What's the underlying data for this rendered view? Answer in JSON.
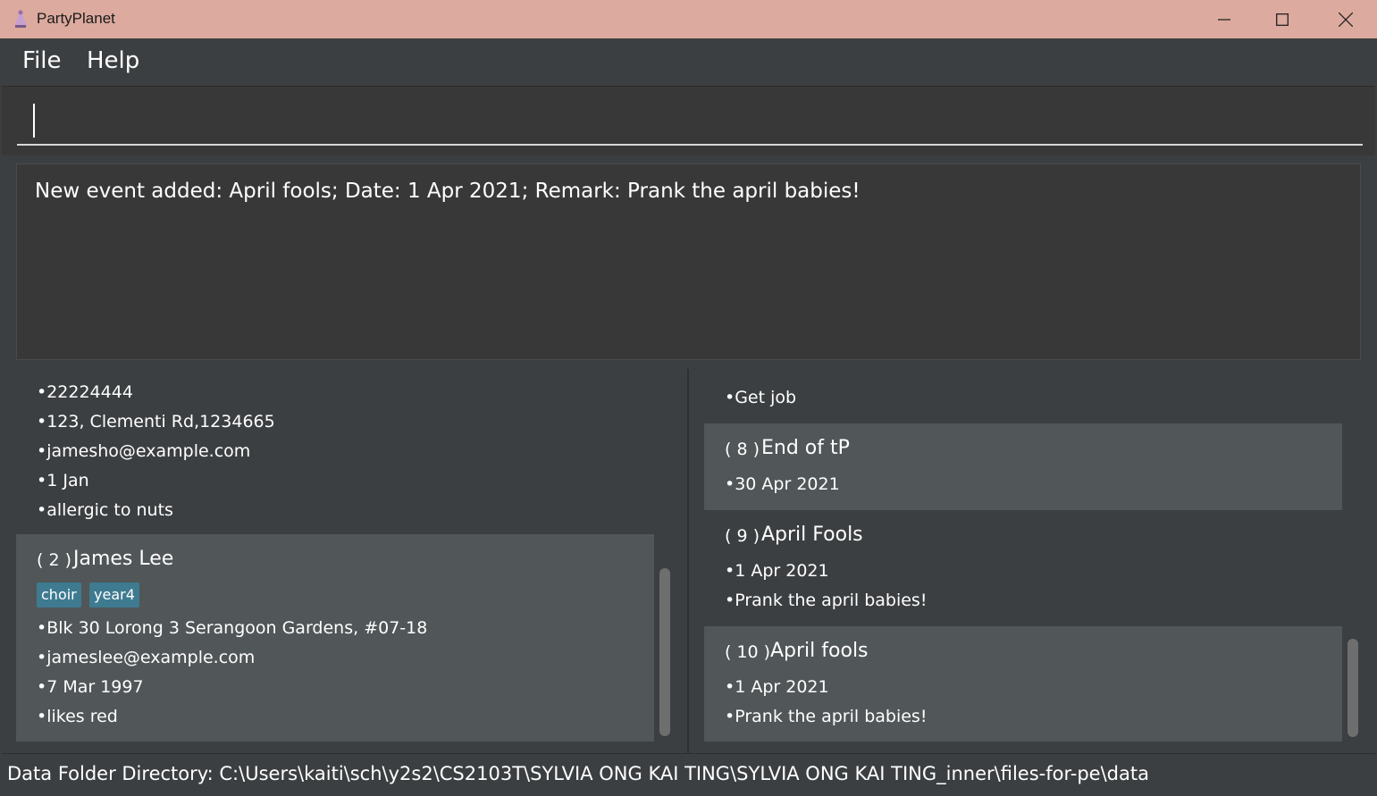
{
  "window": {
    "title": "PartyPlanet"
  },
  "menu": {
    "file": "File",
    "help": "Help"
  },
  "command": {
    "value": ""
  },
  "result": {
    "text": "New event added: April fools; Date: 1 Apr 2021; Remark: Prank the april babies!"
  },
  "persons": [
    {
      "lines": [
        "•22224444",
        "•123, Clementi Rd,1234665",
        "•jamesho@example.com",
        "•1 Jan",
        "•allergic to nuts"
      ]
    },
    {
      "index": "( 2 )",
      "name": "James Lee",
      "tags": [
        "choir",
        "year4"
      ],
      "lines": [
        "•Blk 30 Lorong 3 Serangoon Gardens, #07-18",
        "•jameslee@example.com",
        "•7 Mar 1997",
        "•likes red"
      ]
    }
  ],
  "events": [
    {
      "lines": [
        "•Get job"
      ]
    },
    {
      "index": "( 8 )",
      "name": "End of tP",
      "lines": [
        "•30 Apr 2021"
      ]
    },
    {
      "index": "( 9 )",
      "name": "April Fools",
      "lines": [
        "•1 Apr 2021",
        "•Prank the april babies!"
      ]
    },
    {
      "index": "( 10 )",
      "name": "April fools",
      "lines": [
        "•1 Apr 2021",
        "•Prank the april babies!"
      ]
    }
  ],
  "status": {
    "text": "Data Folder Directory: C:\\Users\\kaiti\\sch\\y2s2\\CS2103T\\SYLVIA ONG KAI TING\\SYLVIA ONG KAI TING_inner\\files-for-pe\\data"
  }
}
